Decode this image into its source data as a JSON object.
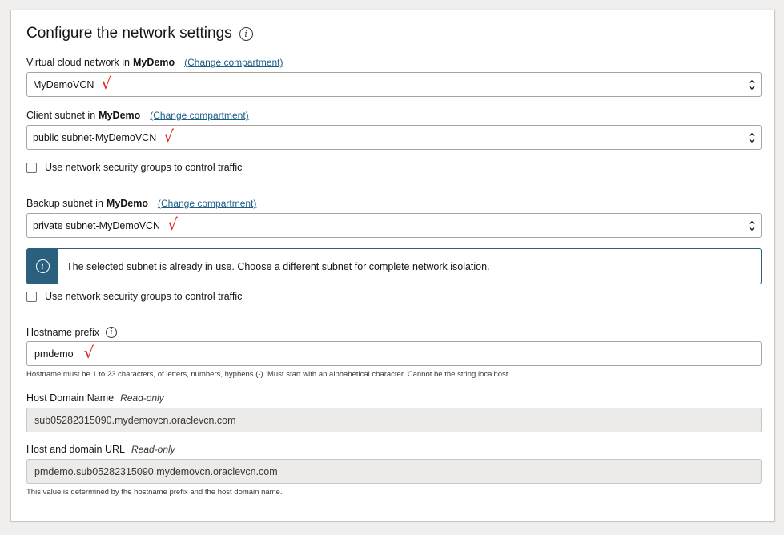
{
  "title": "Configure the network settings",
  "vcn": {
    "label": "Virtual cloud network in",
    "compartment": "MyDemo",
    "change_link": "(Change compartment)",
    "value": "MyDemoVCN"
  },
  "client_subnet": {
    "label": "Client subnet in",
    "compartment": "MyDemo",
    "change_link": "(Change compartment)",
    "value": "public subnet-MyDemoVCN",
    "nsg_checkbox": "Use network security groups to control traffic"
  },
  "backup_subnet": {
    "label": "Backup subnet in",
    "compartment": "MyDemo",
    "change_link": "(Change compartment)",
    "value": "private subnet-MyDemoVCN",
    "notice": "The selected subnet is already in use. Choose a different subnet for complete network isolation.",
    "nsg_checkbox": "Use network security groups to control traffic"
  },
  "hostname": {
    "label": "Hostname prefix",
    "value": "pmdemo",
    "help": "Hostname must be 1 to 23 characters, of letters, numbers, hyphens (-). Must start with an alphabetical character. Cannot be the string localhost."
  },
  "host_domain": {
    "label": "Host Domain Name",
    "readonly": "Read-only",
    "value": "sub05282315090.mydemovcn.oraclevcn.com"
  },
  "host_url": {
    "label": "Host and domain URL",
    "readonly": "Read-only",
    "value": "pmdemo.sub05282315090.mydemovcn.oraclevcn.com",
    "help": "This value is determined by the hostname prefix and the host domain name."
  },
  "annotation_mark": "√",
  "colors": {
    "link": "#1b5e87",
    "notice_accent": "#2a5f7e",
    "annotation": "#e0221b"
  }
}
